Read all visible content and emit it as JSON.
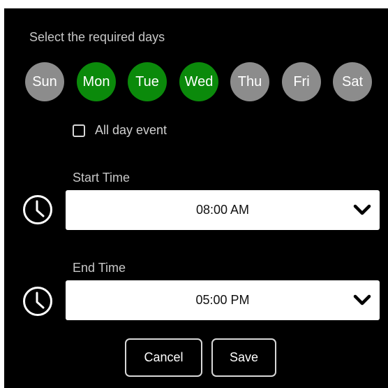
{
  "dialog": {
    "prompt": "Select the required days",
    "days": [
      {
        "label": "Sun",
        "selected": false
      },
      {
        "label": "Mon",
        "selected": true
      },
      {
        "label": "Tue",
        "selected": true
      },
      {
        "label": "Wed",
        "selected": true
      },
      {
        "label": "Thu",
        "selected": false
      },
      {
        "label": "Fri",
        "selected": false
      },
      {
        "label": "Sat",
        "selected": false
      }
    ],
    "all_day": {
      "label": "All day event",
      "checked": false
    },
    "start_time": {
      "label": "Start Time",
      "value": "08:00 AM"
    },
    "end_time": {
      "label": "End Time",
      "value": "05:00 PM"
    },
    "buttons": {
      "cancel": "Cancel",
      "save": "Save"
    }
  },
  "colors": {
    "selected_day": "#0b8a0b",
    "unselected_day": "#8c8c8c",
    "background": "#000000"
  },
  "icons": {
    "time": "clock-icon",
    "dropdown": "chevron-down-icon",
    "checkbox": "checkbox-unchecked-icon"
  }
}
